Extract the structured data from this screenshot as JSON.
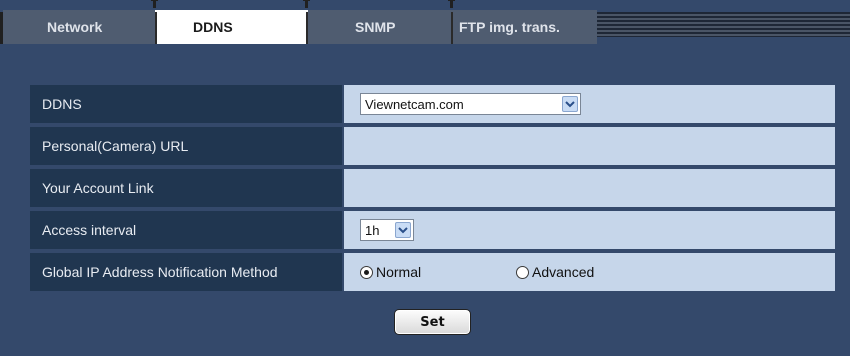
{
  "tabs": [
    {
      "label": "Network",
      "active": false
    },
    {
      "label": "DDNS",
      "active": true
    },
    {
      "label": "SNMP",
      "active": false
    },
    {
      "label": "FTP img. trans.",
      "active": false
    }
  ],
  "form": {
    "ddns": {
      "label": "DDNS",
      "value": "Viewnetcam.com"
    },
    "personal_url": {
      "label": "Personal(Camera) URL",
      "value": ""
    },
    "account_link": {
      "label": "Your Account Link",
      "value": ""
    },
    "access_interval": {
      "label": "Access interval",
      "value": "1h"
    },
    "global_ip": {
      "label": "Global IP Address Notification Method",
      "options": [
        {
          "label": "Normal",
          "checked": true
        },
        {
          "label": "Advanced",
          "checked": false
        }
      ]
    }
  },
  "set_button": {
    "label": "Set"
  },
  "colors": {
    "background": "#34496b",
    "label_cell": "#203650",
    "value_cell": "#c6d6ea",
    "active_tab": "#ffffff",
    "inactive_tab": "#4f5c70"
  }
}
